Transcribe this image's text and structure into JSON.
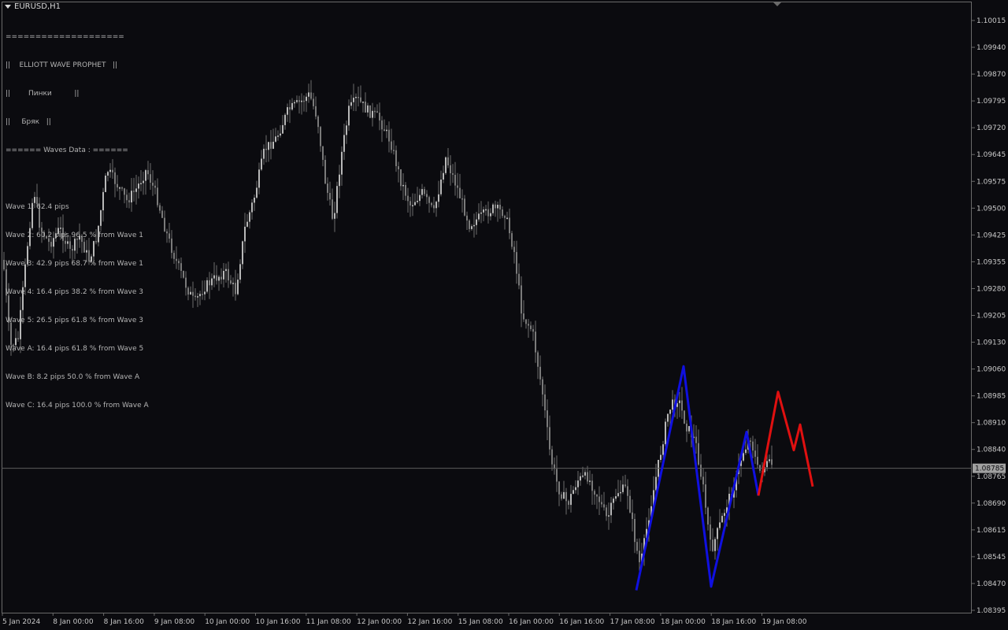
{
  "window": {
    "title": "EURUSD,H1"
  },
  "info_panel": {
    "lines": [
      "====================",
      "||    ELLIOTT WAVE PROPHET   ||",
      "||        Пинки          ||",
      "||     Бряк   ||",
      "====== Waves Data : ======"
    ],
    "waves": [
      "Wave 1: 62.4 pips",
      "Wave 2: 60.2 pips 96.5 % from Wave 1",
      "Wave 3: 42.9 pips 68.7 % from Wave 1",
      "Wave 4: 16.4 pips 38.2 % from Wave 3",
      "Wave 5: 26.5 pips 61.8 % from Wave 3",
      "Wave A: 16.4 pips 61.8 % from Wave 5",
      "Wave B: 8.2 pips 50.0 % from Wave A",
      "Wave C: 16.4 pips 100.0 % from Wave A"
    ]
  },
  "chart_data": {
    "type": "candlestick",
    "symbol": "EURUSD",
    "timeframe": "H1",
    "current_price": "1.08785",
    "y_ticks": [
      "1.10015",
      "1.09940",
      "1.09870",
      "1.09795",
      "1.09720",
      "1.09645",
      "1.09575",
      "1.09500",
      "1.09425",
      "1.09355",
      "1.09280",
      "1.09205",
      "1.09130",
      "1.09060",
      "1.08985",
      "1.08910",
      "1.08840",
      "1.08765",
      "1.08690",
      "1.08615",
      "1.08545",
      "1.08470",
      "1.08395"
    ],
    "ylim": [
      1.0839,
      1.1005
    ],
    "x_ticks": [
      "5 Jan 2024",
      "8 Jan 00:00",
      "8 Jan 16:00",
      "9 Jan 08:00",
      "10 Jan 00:00",
      "10 Jan 16:00",
      "11 Jan 08:00",
      "12 Jan 00:00",
      "12 Jan 16:00",
      "15 Jan 08:00",
      "16 Jan 00:00",
      "16 Jan 16:00",
      "17 Jan 08:00",
      "18 Jan 00:00",
      "18 Jan 16:00",
      "19 Jan 08:00"
    ],
    "wave_pattern_blue": [
      [
        808,
        1.0845
      ],
      [
        868,
        1.09065
      ],
      [
        903,
        1.0846
      ],
      [
        948,
        1.08885
      ],
      [
        963,
        1.0871
      ]
    ],
    "projection_red": [
      [
        963,
        1.0871
      ],
      [
        988,
        1.08995
      ],
      [
        1008,
        1.08835
      ],
      [
        1016,
        1.08905
      ],
      [
        1032,
        1.08735
      ]
    ],
    "colors": {
      "background": "#0b0b0f",
      "candle": "#8a8a8a",
      "wave_line": "#1010e0",
      "projection_line": "#e01010",
      "price_line": "#5a5a5a",
      "price_label_bg": "#a0a0a0"
    }
  }
}
